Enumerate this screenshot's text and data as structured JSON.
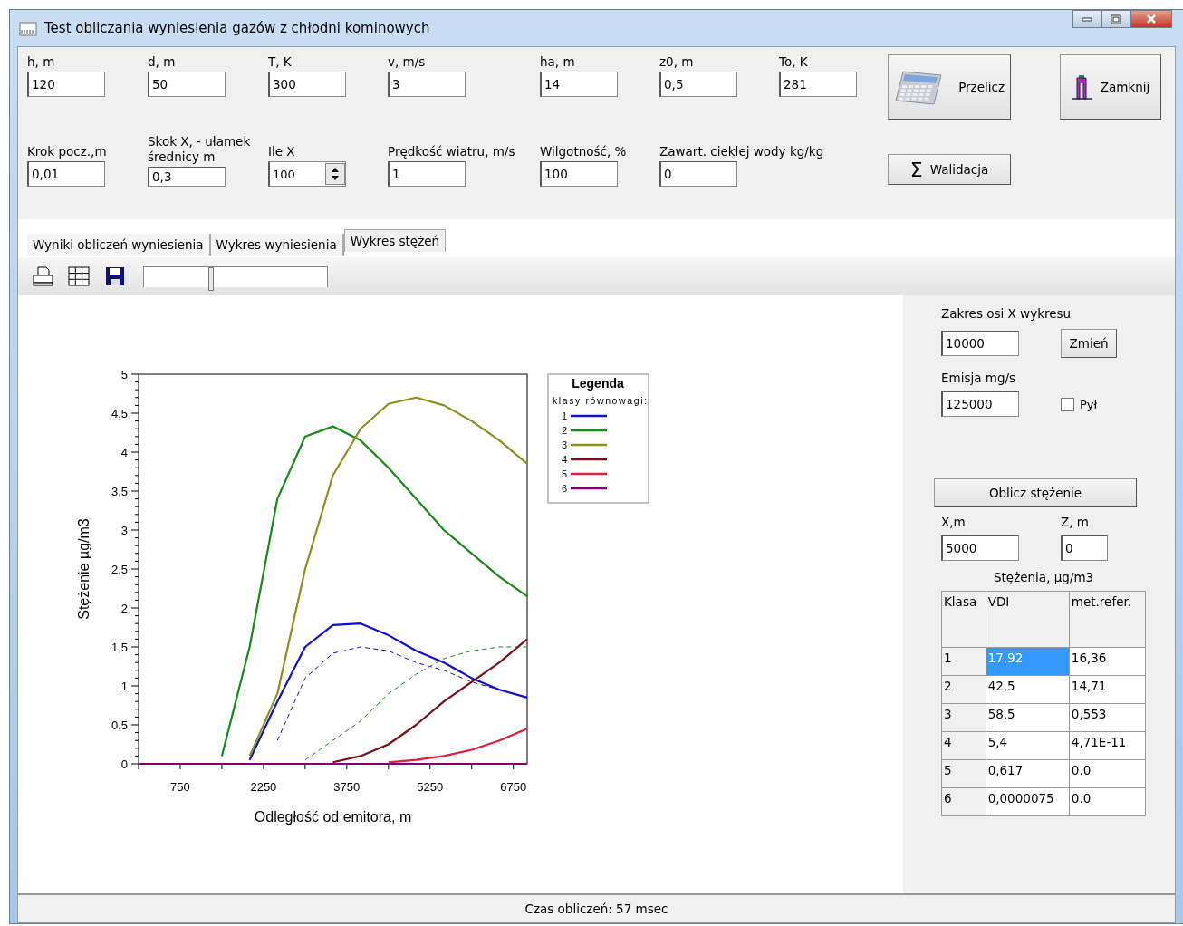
{
  "window": {
    "title": "Test obliczania wyniesienia gazów z chłodni kominowych"
  },
  "parameters": [
    {
      "label": "h, m",
      "value": "120"
    },
    {
      "label": "d, m",
      "value": "50"
    },
    {
      "label": "T, K",
      "value": "300"
    },
    {
      "label": "v, m/s",
      "value": "3"
    },
    {
      "label": "ha, m",
      "value": "14"
    },
    {
      "label": "z0, m",
      "value": "0,5"
    },
    {
      "label": "To, K",
      "value": "281"
    },
    {
      "label": "Krok pocz.,m",
      "value": "0,01",
      "kind": "text"
    },
    {
      "label": "Skok  X, - ułamek średnicy m",
      "value": "0,3",
      "kind": "text"
    },
    {
      "label": "Ile X",
      "value": "100",
      "kind": "spinner"
    },
    {
      "label": "Prędkość wiatru, m/s",
      "value": "1",
      "kind": "text"
    },
    {
      "label": "Wilgotność, %",
      "value": "100",
      "kind": "text"
    },
    {
      "label": "Zawart. ciekłej wody kg/kg",
      "value": "0",
      "kind": "text"
    }
  ],
  "buttons": {
    "recalculate": "Przelicz",
    "close": "Zamknij",
    "validate": {
      "icon": "Σ",
      "label": "Walidacja"
    }
  },
  "tabs": [
    {
      "label": "Wyniki obliczeń wyniesienia",
      "selected": false
    },
    {
      "label": "Wykres wyniesienia",
      "selected": false
    },
    {
      "label": "Wykres stężeń",
      "selected": true
    }
  ],
  "toolbar": {
    "zoom_slider": {
      "level": 0.36
    }
  },
  "chart": {
    "legend": {
      "title": "Legenda",
      "subtitle": "klasy równowagi:"
    },
    "chart_data": {
      "type": "line",
      "legend": "right",
      "xlabel": "Odległość od emitora, m",
      "ylabel": "Stężenie µg/m3",
      "xlim": [
        0,
        7000
      ],
      "ylim": [
        0,
        5
      ],
      "xticks": [
        750,
        2250,
        3750,
        5250,
        6750
      ],
      "yticks": [
        {
          "value": 0,
          "label": "0"
        },
        {
          "value": 0.5,
          "label": "0,5"
        },
        {
          "value": 1,
          "label": "1"
        },
        {
          "value": 1.5,
          "label": "1,5"
        },
        {
          "value": 2,
          "label": "2"
        },
        {
          "value": 2.5,
          "label": "2,5"
        },
        {
          "value": 3,
          "label": "3"
        },
        {
          "value": 3.5,
          "label": "3,5"
        },
        {
          "value": 4,
          "label": "4"
        },
        {
          "value": 4.5,
          "label": "4,5"
        },
        {
          "value": 5,
          "label": "5"
        }
      ],
      "x": [
        0,
        500,
        1000,
        1500,
        2000,
        2500,
        3000,
        3500,
        4000,
        4500,
        5000,
        5500,
        6000,
        6500,
        7000
      ],
      "series": [
        {
          "name": "1",
          "color": "#1010d0",
          "values": [
            null,
            null,
            null,
            null,
            0.05,
            0.8,
            1.5,
            1.78,
            1.8,
            1.65,
            1.45,
            1.3,
            1.1,
            0.95,
            0.85
          ]
        },
        {
          "name": "2",
          "color": "#178a17",
          "values": [
            null,
            null,
            null,
            0.1,
            1.5,
            3.4,
            4.2,
            4.33,
            4.15,
            3.8,
            3.4,
            3.0,
            2.7,
            2.4,
            2.15
          ]
        },
        {
          "name": "3",
          "color": "#8f8f1f",
          "values": [
            null,
            null,
            null,
            null,
            0.1,
            0.9,
            2.5,
            3.7,
            4.3,
            4.62,
            4.7,
            4.6,
            4.4,
            4.15,
            3.85
          ]
        },
        {
          "name": "4",
          "color": "#7a0f1f",
          "values": [
            null,
            null,
            null,
            null,
            null,
            null,
            null,
            0.02,
            0.1,
            0.25,
            0.5,
            0.8,
            1.05,
            1.3,
            1.6
          ]
        },
        {
          "name": "5",
          "color": "#e0203a",
          "values": [
            null,
            null,
            null,
            null,
            null,
            null,
            null,
            null,
            null,
            0.02,
            0.05,
            0.1,
            0.18,
            0.3,
            0.45
          ]
        },
        {
          "name": "6",
          "color": "#800080",
          "values": [
            0,
            0,
            0,
            0,
            0,
            0,
            0,
            0,
            0,
            0,
            0,
            0,
            0,
            0,
            0
          ]
        },
        {
          "color": "#1010d0",
          "line_style": "dashed",
          "values": [
            null,
            null,
            null,
            null,
            null,
            0.3,
            1.1,
            1.42,
            1.5,
            1.45,
            1.3,
            1.2,
            1.05,
            0.95,
            0.85
          ]
        },
        {
          "color": "#178a17",
          "line_style": "dashed",
          "values": [
            null,
            null,
            null,
            null,
            null,
            null,
            0.05,
            0.3,
            0.55,
            0.9,
            1.15,
            1.35,
            1.45,
            1.5,
            1.5
          ]
        }
      ]
    }
  },
  "side_panel": {
    "range": {
      "label": "Zakres osi X wykresu",
      "value": "10000",
      "button": "Zmień"
    },
    "emission": {
      "label": "Emisja mg/s",
      "value": "125000",
      "checkbox": {
        "label": "Pył",
        "checked": false
      }
    },
    "compute_button": "Oblicz stężenie",
    "x": {
      "label": "X,m",
      "value": "5000"
    },
    "z": {
      "label": "Z, m",
      "value": "0"
    },
    "table": {
      "title": "Stężenia, µg/m3",
      "columns": [
        "Klasa",
        "VDI",
        "met.refer."
      ],
      "rows": [
        {
          "cells": [
            "1",
            "17,92",
            "16,36"
          ],
          "selected": true
        },
        {
          "cells": [
            "2",
            "42,5",
            "14,71"
          ],
          "selected": false
        },
        {
          "cells": [
            "3",
            "58,5",
            "0,553"
          ],
          "selected": false
        },
        {
          "cells": [
            "4",
            "5,4",
            "4,71E-11"
          ],
          "selected": false
        },
        {
          "cells": [
            "5",
            "0,617",
            "0.0"
          ],
          "selected": false
        },
        {
          "cells": [
            "6",
            "0,0000075",
            "0.0"
          ],
          "selected": false
        }
      ]
    }
  },
  "status_bar": "Czas obliczeń: 57 msec"
}
